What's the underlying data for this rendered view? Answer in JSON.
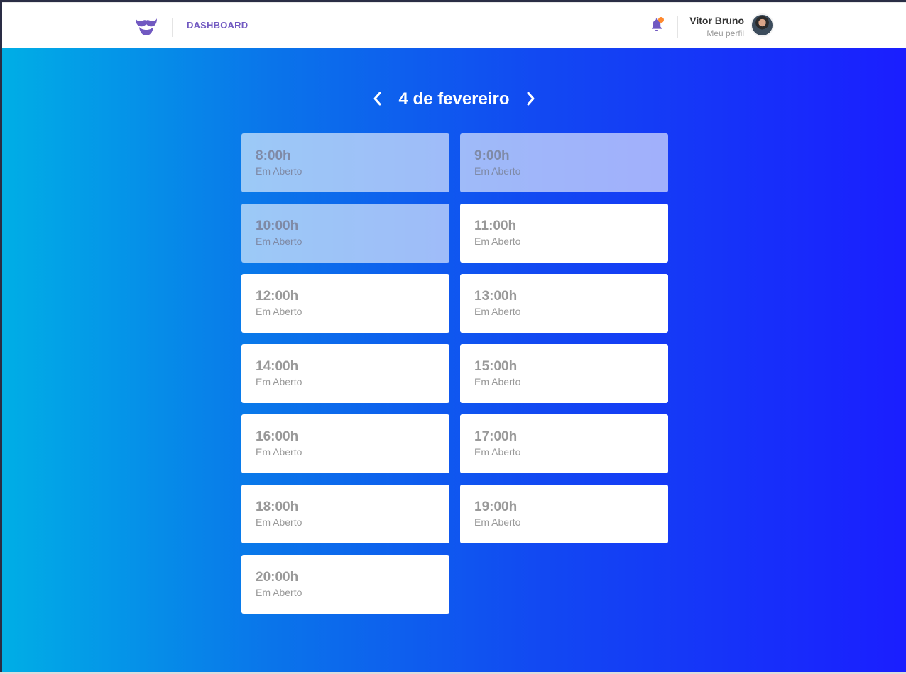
{
  "header": {
    "logo_icon": "mustache-logo-icon",
    "nav_label": "DASHBOARD",
    "notification_icon": "bell-icon",
    "notification_dot_color": "#ff892e",
    "user_name": "Vitor Bruno",
    "profile_link": "Meu perfil",
    "brand_color": "#7159c1"
  },
  "schedule": {
    "date_title": "4 de fevereiro",
    "prev_icon": "chevron-left-icon",
    "next_icon": "chevron-right-icon",
    "slots": [
      {
        "time": "8:00h",
        "status": "Em Aberto",
        "past": true
      },
      {
        "time": "9:00h",
        "status": "Em Aberto",
        "past": true
      },
      {
        "time": "10:00h",
        "status": "Em Aberto",
        "past": true
      },
      {
        "time": "11:00h",
        "status": "Em Aberto",
        "past": false
      },
      {
        "time": "12:00h",
        "status": "Em Aberto",
        "past": false
      },
      {
        "time": "13:00h",
        "status": "Em Aberto",
        "past": false
      },
      {
        "time": "14:00h",
        "status": "Em Aberto",
        "past": false
      },
      {
        "time": "15:00h",
        "status": "Em Aberto",
        "past": false
      },
      {
        "time": "16:00h",
        "status": "Em Aberto",
        "past": false
      },
      {
        "time": "17:00h",
        "status": "Em Aberto",
        "past": false
      },
      {
        "time": "18:00h",
        "status": "Em Aberto",
        "past": false
      },
      {
        "time": "19:00h",
        "status": "Em Aberto",
        "past": false
      },
      {
        "time": "20:00h",
        "status": "Em Aberto",
        "past": false
      }
    ]
  }
}
